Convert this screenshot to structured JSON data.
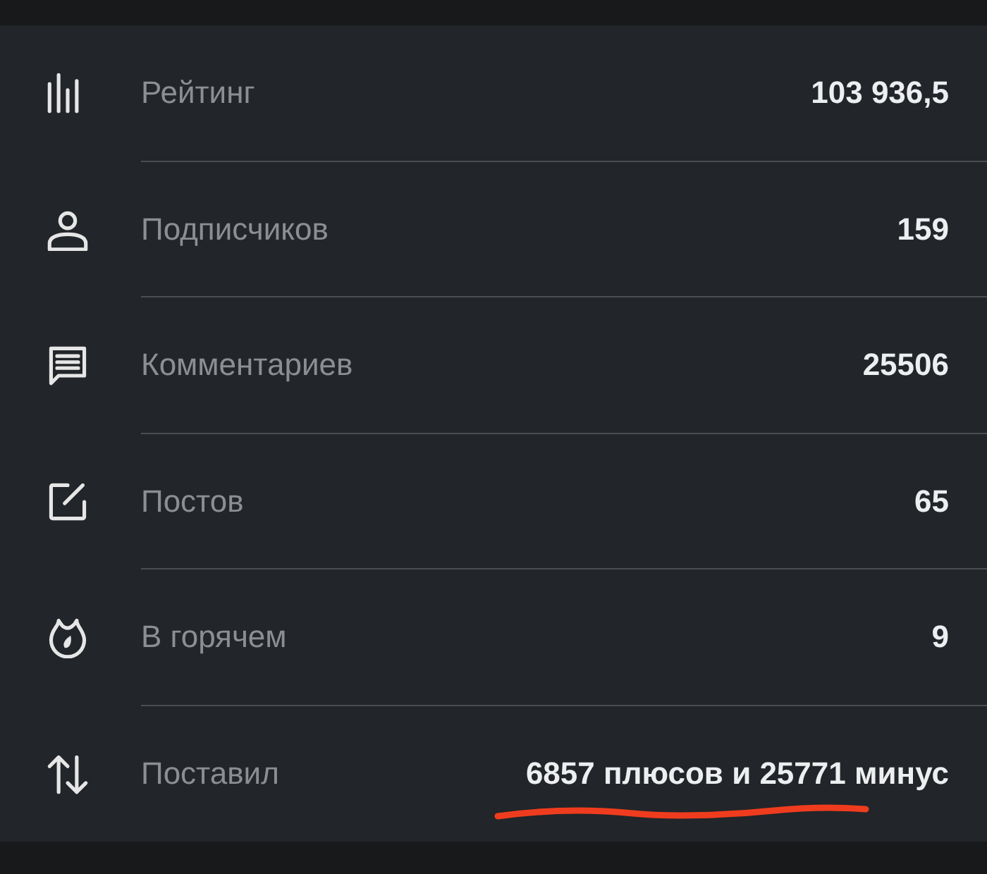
{
  "stats": [
    {
      "label": "Рейтинг",
      "value": "103 936,5",
      "underlined": false
    },
    {
      "label": "Подписчиков",
      "value": "159",
      "underlined": false
    },
    {
      "label": "Комментариев",
      "value": "25506",
      "underlined": false
    },
    {
      "label": "Постов",
      "value": "65",
      "underlined": false
    },
    {
      "label": "В горячем",
      "value": "9",
      "underlined": false
    },
    {
      "label": "Поставил",
      "value": "6857 плюсов и 25771 минус",
      "underlined": true
    }
  ]
}
